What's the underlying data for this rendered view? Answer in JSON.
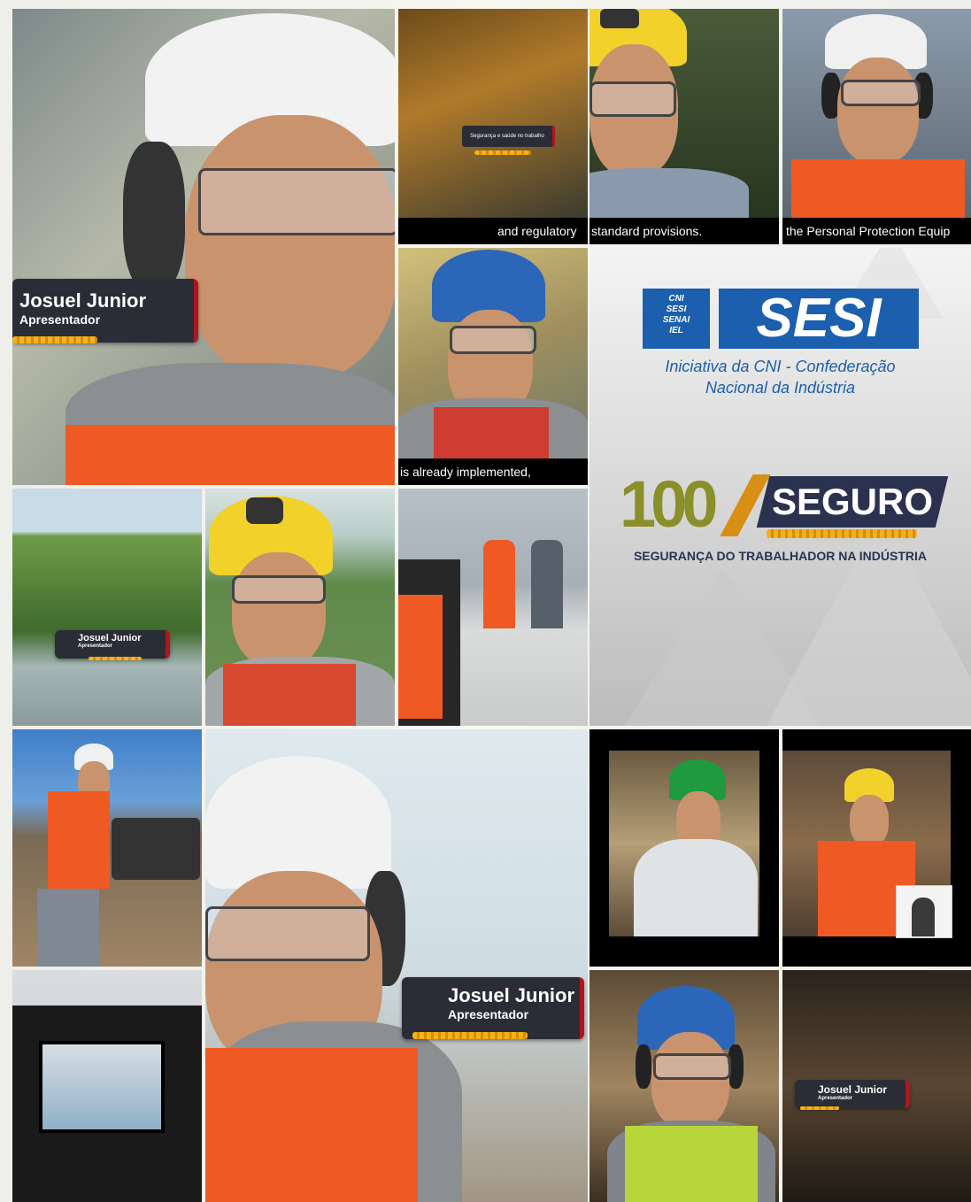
{
  "collage": {
    "subtitles": {
      "s1": "and regulatory",
      "s2": "standard provisions.",
      "s3": "the Personal Protection Equip",
      "s4": "is already implemented,"
    },
    "presenter": {
      "name": "Josuel Junior",
      "role": "Apresentador"
    },
    "small_caption": "Segurança e saúde no trabalho",
    "brand": {
      "logo_lines": [
        "CNI",
        "SESI",
        "SENAI",
        "IEL"
      ],
      "sesi": "SESI",
      "tagline1": "Iniciativa da CNI - Confederação",
      "tagline2": "Nacional da Indústria",
      "campaign_number": "100",
      "campaign_word": "SEGURO",
      "campaign_sub": "SEGURANÇA DO TRABALHADOR NA INDÚSTRIA"
    },
    "colors": {
      "sesi_blue": "#1b5fae",
      "campaign_olive": "#8a8f2a",
      "campaign_navy": "#2b3250",
      "safety_orange": "#ef5a24",
      "lower_third_red": "#b3141e",
      "bar_yellow": "#f5b11a"
    }
  }
}
